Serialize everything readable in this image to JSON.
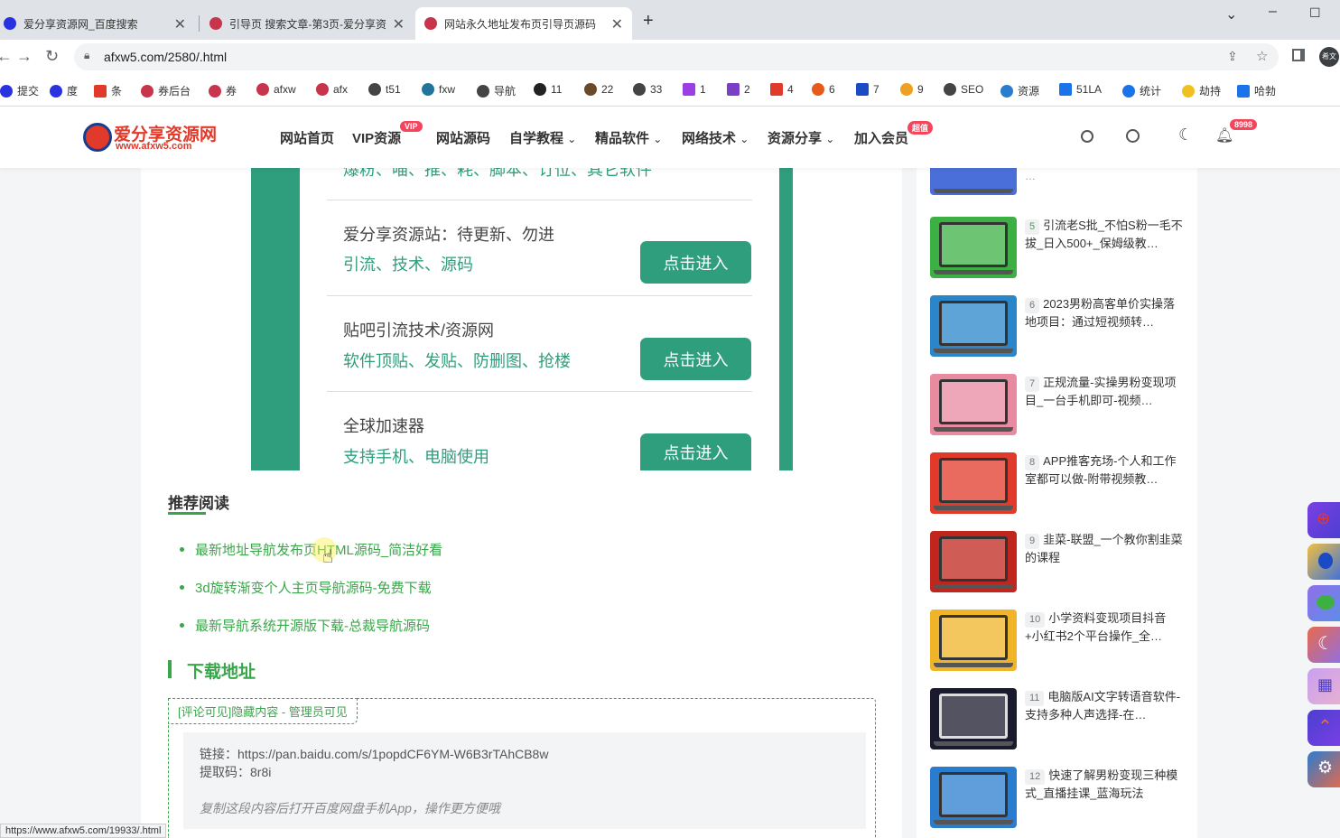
{
  "browser": {
    "tabs": [
      {
        "title": "爱分享资源网_百度搜索",
        "fav_color": "#2932e1"
      },
      {
        "title": "引导页 搜索文章-第3页-爱分享资",
        "fav_color": "#c8344b"
      },
      {
        "title": "网站永久地址发布页引导页源码",
        "fav_color": "#c8344b"
      }
    ],
    "new_tab": "+",
    "url": "afxw5.com/2580/.html",
    "profile": "希文",
    "bookmarks": [
      "提交",
      "度",
      "条",
      "券后台",
      "券",
      "afxw",
      "afx",
      "t51",
      "fxw",
      "导航",
      "11",
      "22",
      "33",
      "1",
      "2",
      "4",
      "6",
      "7",
      "9",
      "SEO",
      "资源",
      "51LA",
      "统计",
      "劫持",
      "哈勃"
    ]
  },
  "site": {
    "logo_text": "爱分享资源网",
    "logo_sub": "www.afxw5.com",
    "nav": [
      {
        "label": "网站首页"
      },
      {
        "label": "VIP资源",
        "badge": "VIP"
      },
      {
        "label": "网站源码"
      },
      {
        "label": "自学教程",
        "caret": "⌄"
      },
      {
        "label": "精品软件",
        "caret": "⌄"
      },
      {
        "label": "网络技术",
        "caret": "⌄"
      },
      {
        "label": "资源分享",
        "caret": "⌄"
      },
      {
        "label": "加入会员",
        "badge": "超值"
      }
    ],
    "notif_count": "8998"
  },
  "guide": {
    "partial_sub": "爆粉、喵、推、耗、脚本、订位、其它软件",
    "rows": [
      {
        "title": "爱分享资源站：待更新、勿进",
        "sub": "引流、技术、源码",
        "btn": "点击进入"
      },
      {
        "title": "贴吧引流技术/资源网",
        "sub": "软件顶贴、发贴、防删图、抢楼",
        "btn": "点击进入"
      },
      {
        "title": "全球加速器",
        "sub": "支持手机、电脑使用",
        "btn": "点击进入"
      }
    ]
  },
  "recommend": {
    "heading": "推荐阅读",
    "items": [
      "最新地址导航发布页HTML源码_简洁好看",
      "3d旋转渐变个人主页导航源码-免费下载",
      "最新导航系统开源版下载-总裁导航源码"
    ]
  },
  "download": {
    "heading": "下载地址",
    "tag": "[评论可见]隐藏内容 - 管理员可见",
    "link_line": "链接：https://pan.baidu.com/s/1popdCF6YM-W6B3rTAhCB8w",
    "code_line": "提取码：8r8i",
    "note": "复制这段内容后打开百度网盘手机App，操作更方便哦"
  },
  "sidebar": {
    "items": [
      {
        "num": "5",
        "text": "引流老S批_不怕S粉一毛不拔_日入500+_保姆级教…",
        "color": "#3cb043"
      },
      {
        "num": "6",
        "text": "2023男粉高客单价实操落地项目：通过短视频转…",
        "color": "#2a86c8"
      },
      {
        "num": "7",
        "text": "正规流量-实操男粉变现项目_一台手机即可-视频…",
        "color": "#e88aa0"
      },
      {
        "num": "8",
        "text": "APP推客充场-个人和工作室都可以做-附带视频教…",
        "color": "#e23a2a"
      },
      {
        "num": "9",
        "text": "韭菜-联盟_一个教你割韭菜的课程",
        "color": "#c0261e"
      },
      {
        "num": "10",
        "text": "小学资料变现项目抖音+小红书2个平台操作_全…",
        "color": "#f0b429"
      },
      {
        "num": "11",
        "text": "电脑版AI文字转语音软件-支持多种人声选择-在…",
        "color": "#1a1a2e"
      },
      {
        "num": "12",
        "text": "快速了解男粉变现三种模式_直播挂课_蓝海玩法",
        "color": "#2a7ccf"
      }
    ]
  },
  "floaters": [
    "#7b3fe4",
    "#3b6fe0",
    "#5b8fe8",
    "#e86a4a",
    "#8f6fe8",
    "#4b3fd0",
    "#2a7ccf"
  ],
  "status_url": "https://www.afxw5.com/19933/.html"
}
